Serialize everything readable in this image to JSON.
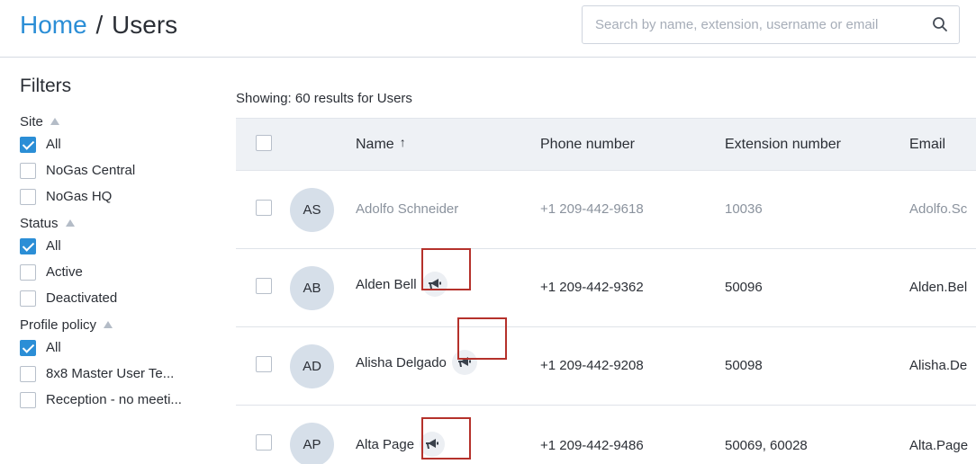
{
  "breadcrumb": {
    "home": "Home",
    "separator": "/",
    "current": "Users"
  },
  "search": {
    "placeholder": "Search by name, extension, username or email",
    "value": "",
    "icon": "search-icon"
  },
  "filters": {
    "title": "Filters",
    "groups": [
      {
        "title": "Site",
        "options": [
          {
            "label": "All",
            "checked": true
          },
          {
            "label": "NoGas Central",
            "checked": false
          },
          {
            "label": "NoGas HQ",
            "checked": false
          }
        ]
      },
      {
        "title": "Status",
        "options": [
          {
            "label": "All",
            "checked": true
          },
          {
            "label": "Active",
            "checked": false
          },
          {
            "label": "Deactivated",
            "checked": false
          }
        ]
      },
      {
        "title": "Profile policy",
        "options": [
          {
            "label": "All",
            "checked": true
          },
          {
            "label": "8x8 Master User Te...",
            "checked": false
          },
          {
            "label": "Reception - no meeti...",
            "checked": false
          }
        ]
      }
    ]
  },
  "results": {
    "showing": "Showing: 60 results for Users"
  },
  "table": {
    "columns": {
      "name": "Name",
      "sort_indicator": "↑",
      "phone": "Phone number",
      "extension": "Extension number",
      "email": "Email"
    },
    "rows": [
      {
        "initials": "AS",
        "name": "Adolfo Schneider",
        "phone": "+1 209-442-9618",
        "extension": "10036",
        "email": "Adolfo.Sc",
        "deactivated": true,
        "broadcast_icon": false
      },
      {
        "initials": "AB",
        "name": "Alden Bell",
        "phone": "+1 209-442-9362",
        "extension": "50096",
        "email": "Alden.Bel",
        "deactivated": false,
        "broadcast_icon": true
      },
      {
        "initials": "AD",
        "name": "Alisha Delgado",
        "phone": "+1 209-442-9208",
        "extension": "50098",
        "email": "Alisha.De",
        "deactivated": false,
        "broadcast_icon": true
      },
      {
        "initials": "AP",
        "name": "Alta Page",
        "phone": "+1 209-442-9486",
        "extension": "50069, 60028",
        "email": "Alta.Page",
        "deactivated": false,
        "broadcast_icon": true
      }
    ]
  },
  "colors": {
    "accent": "#2b8ed6",
    "highlight": "#b5312b",
    "header_bg": "#eef1f5",
    "avatar_bg": "#d6dfe9"
  }
}
